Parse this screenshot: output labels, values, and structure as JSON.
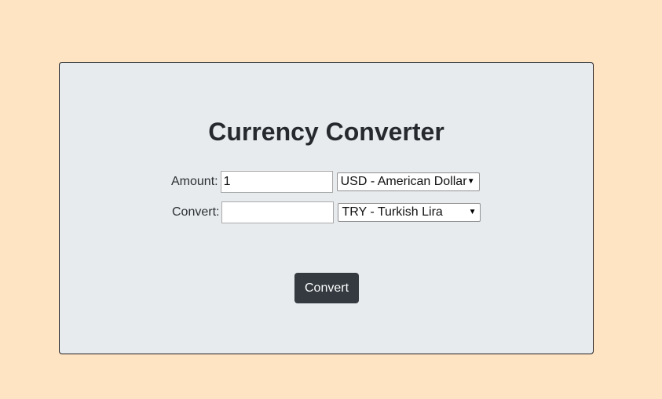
{
  "converter": {
    "title": "Currency Converter",
    "amount_label": "Amount:",
    "amount_value": "1",
    "from_currency": "USD - American Dollar",
    "convert_label": "Convert:",
    "convert_value": "",
    "to_currency": "TRY - Turkish Lira",
    "convert_button": "Convert",
    "caret_icon": "caret-down-icon"
  },
  "colors": {
    "background": "#ffe4c4",
    "card": "#e8ebee",
    "button": "#343a40"
  }
}
